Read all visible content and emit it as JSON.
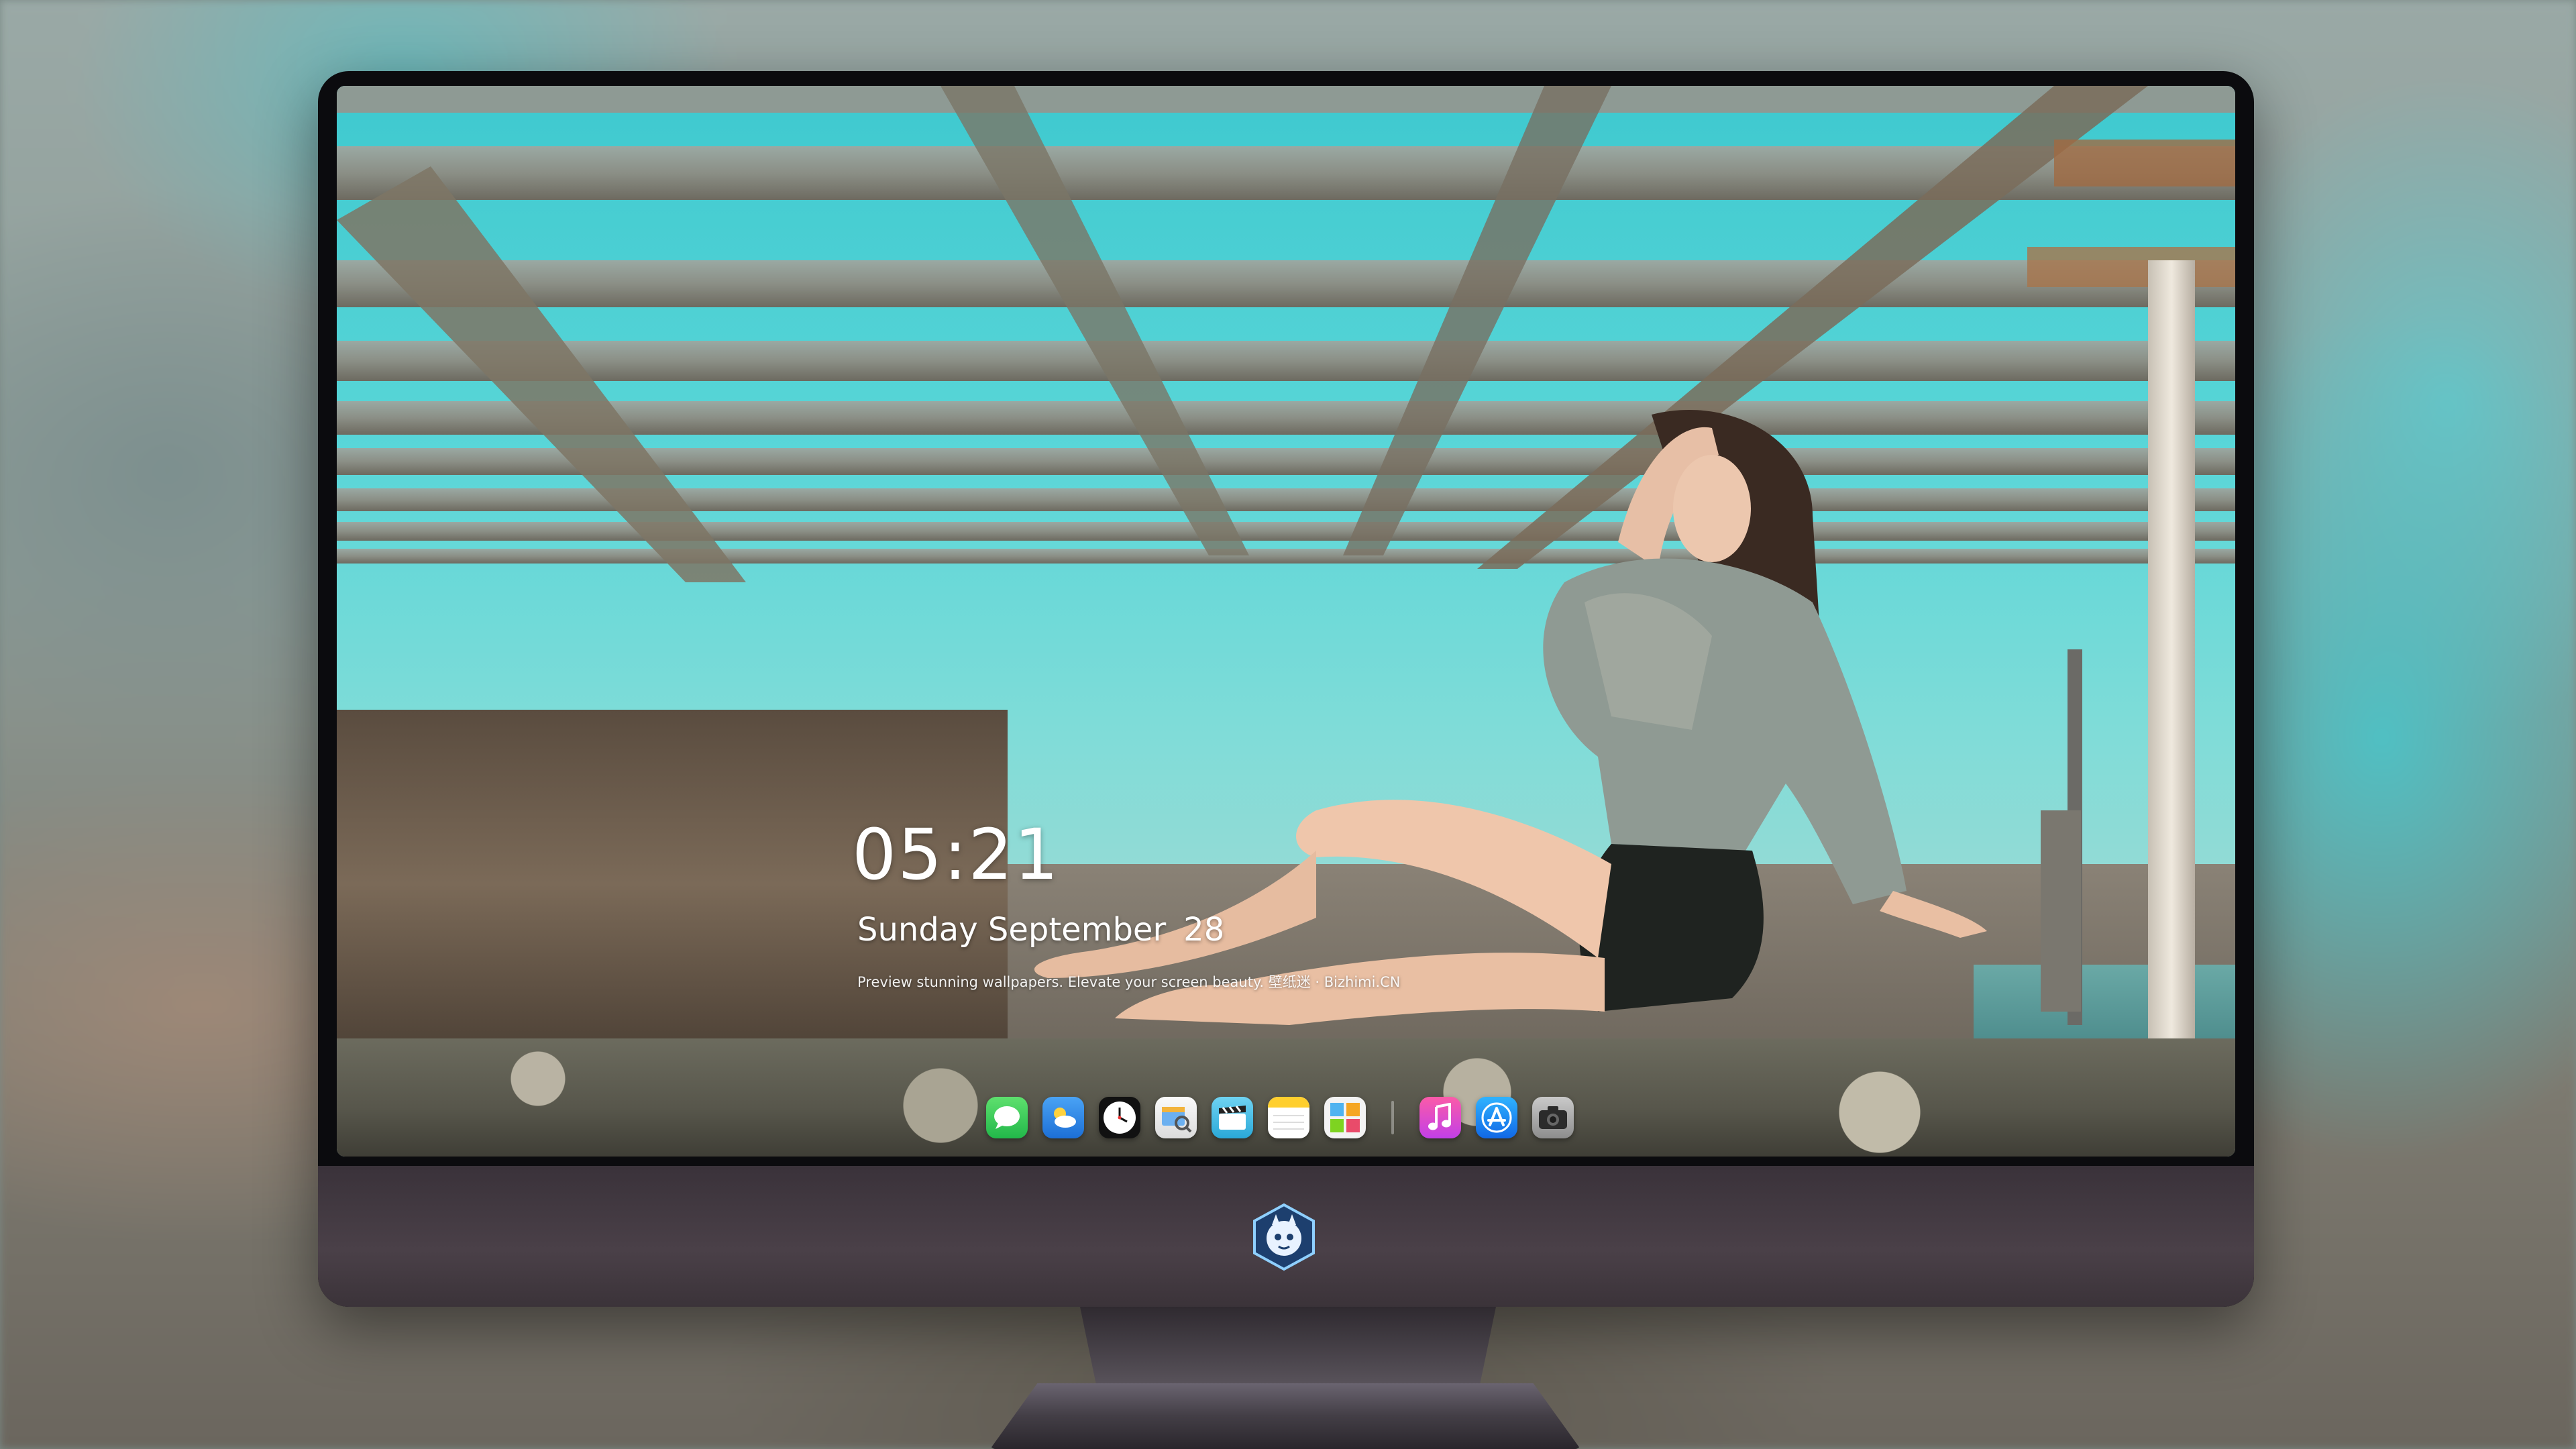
{
  "lockscreen": {
    "time": "05:21",
    "weekday_month": "Sunday September",
    "day": "28",
    "tagline": "Preview stunning wallpapers. Elevate your screen beauty. 壁纸迷 · Bizhimi.CN"
  },
  "dock": {
    "apps": [
      {
        "name": "messages-icon",
        "color": "#34c759"
      },
      {
        "name": "weather-icon",
        "color": "#2f8ff0"
      },
      {
        "name": "clock-icon",
        "color": "#111111"
      },
      {
        "name": "preview-icon",
        "color": "#f2f2f2"
      },
      {
        "name": "claquette-icon",
        "color": "#4fc3e8"
      },
      {
        "name": "notes-icon",
        "color": "#ffd33d"
      },
      {
        "name": "photos-grid-icon",
        "color": "#f3f3f3"
      },
      {
        "name": "music-icon",
        "color": "#fa3f8e"
      },
      {
        "name": "app-store-icon",
        "color": "#1e90ff"
      },
      {
        "name": "camera-icon",
        "color": "#9a9a9a"
      }
    ]
  },
  "colors": {
    "sky": "#3ec9cf",
    "monitor_bezel": "#0b0b0e",
    "monitor_chin": "#4a4048"
  }
}
